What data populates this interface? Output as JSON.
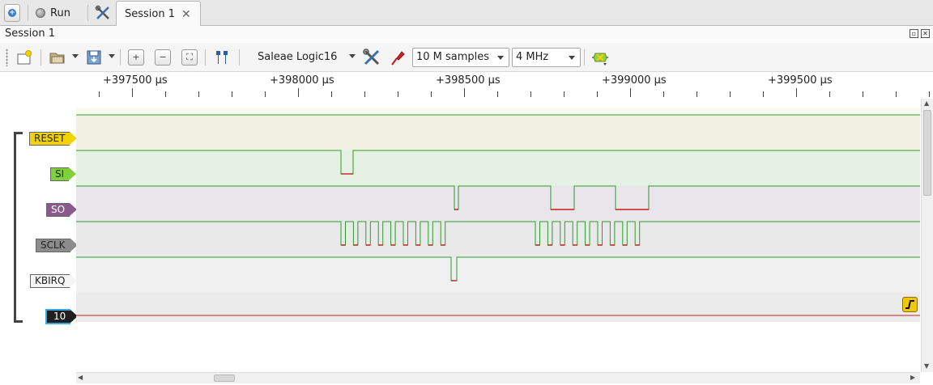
{
  "tabbar": {
    "run_label": "Run",
    "session_tab_label": "Session 1"
  },
  "session": {
    "title": "Session 1"
  },
  "toolbar": {
    "device": "Saleae Logic16",
    "samples": "10 M samples",
    "rate": "4 MHz"
  },
  "ruler": {
    "ticks": [
      "+397500 µs",
      "+398000 µs",
      "+398500 µs",
      "+399000 µs",
      "+399500 µs"
    ]
  },
  "channels": [
    {
      "name": "RESET",
      "color": "#f2d200",
      "text_color": "#222222"
    },
    {
      "name": "SI",
      "color": "#7fd03a",
      "text_color": "#222222"
    },
    {
      "name": "SO",
      "color": "#8a5a8c",
      "text_color": "#ffffff"
    },
    {
      "name": "SCLK",
      "color": "#8c8c8c",
      "text_color": "#222222"
    },
    {
      "name": "KBIRQ",
      "color": "#f5f5f5",
      "text_color": "#222222"
    },
    {
      "name": "10",
      "color": "#1f1f1f",
      "text_color": "#ffffff"
    }
  ],
  "colors": {
    "signal_high": "#2e9a2e",
    "signal_low": "#c0201f",
    "trigger": "#f4c600"
  },
  "icons": [
    "new-tab-icon",
    "run-status-icon",
    "tools-icon",
    "close-icon",
    "new-session-icon",
    "open-file-icon",
    "save-file-icon",
    "zoom-in-icon",
    "zoom-out-icon",
    "zoom-fit-icon",
    "markers-icon",
    "device-settings-icon",
    "probe-icon",
    "analyzer-icon",
    "trigger-rising-edge-icon"
  ]
}
